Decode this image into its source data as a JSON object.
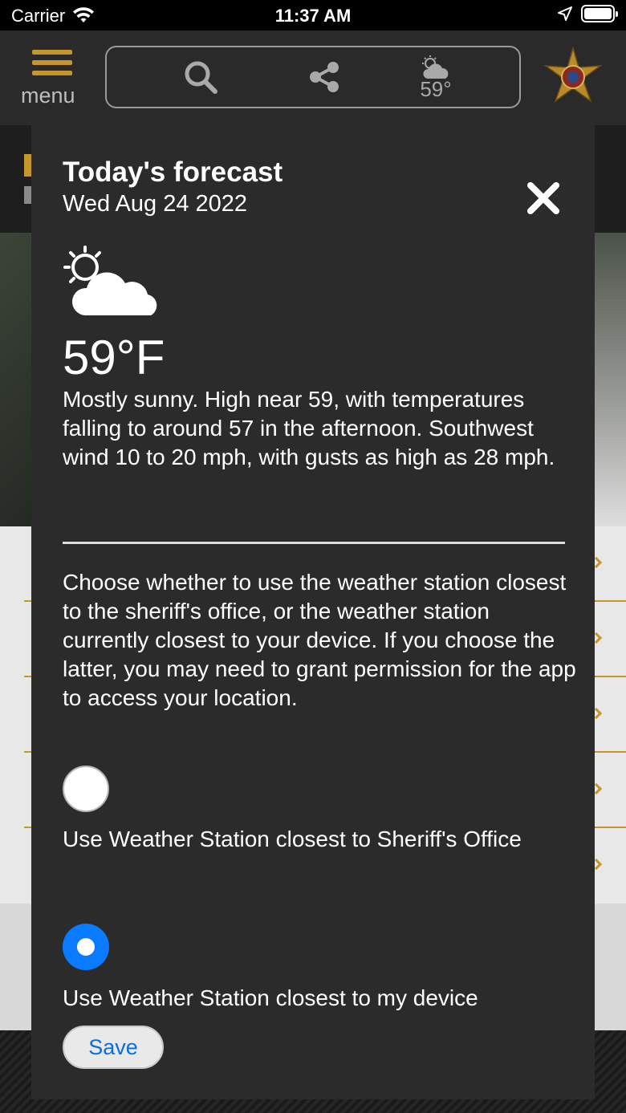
{
  "status_bar": {
    "carrier": "Carrier",
    "time": "11:37 AM",
    "battery_level": 1.0
  },
  "header": {
    "menu_label": "menu",
    "weather_temp": "59°",
    "icons": [
      "hamburger-icon",
      "search-icon",
      "share-icon",
      "partly-sunny-icon",
      "sheriff-badge-logo"
    ]
  },
  "modal": {
    "title": "Today's forecast",
    "date": "Wed Aug 24 2022",
    "temperature": "59°F",
    "description": "Mostly sunny. High near 59, with temperatures falling to around 57 in the afternoon. Southwest wind 10 to 20 mph, with gusts as high as 28 mph.",
    "choose_text": "Choose whether to use the weather station closest to the sheriff's office, or the weather station currently closest to your device. If you choose the latter, you may need to grant permission for the app to access your location.",
    "options": [
      {
        "label": "Use Weather Station closest to Sheriff's Office",
        "selected": false
      },
      {
        "label": "Use Weather Station closest to my device",
        "selected": true
      }
    ],
    "save_label": "Save"
  },
  "colors": {
    "accent_gold": "#c4962c",
    "radio_blue": "#0a7bff",
    "modal_bg": "#2b2b2b",
    "link_blue": "#0a6fd8"
  }
}
